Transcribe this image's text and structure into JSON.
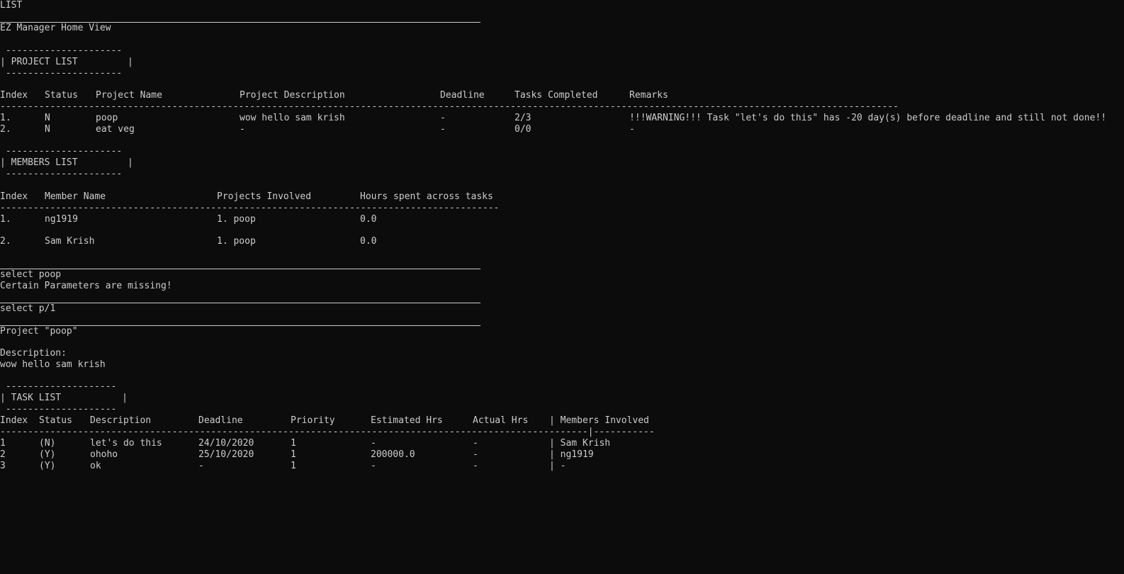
{
  "terminal": {
    "cmd_list": "LIST",
    "home_title": "EZ Manager Home View",
    "project_box": {
      "top": " ---------------------",
      "mid": "| PROJECT LIST         |",
      "bot": " ---------------------"
    },
    "project_table": {
      "headers": [
        "Index",
        "Status",
        "Project Name",
        "Project Description",
        "Deadline",
        "Tasks Completed",
        "Remarks"
      ],
      "divider": "------------------------------------------------------------------------------------------------------------------------------------------------------------------",
      "rows": [
        [
          "1.",
          "N",
          "poop",
          "wow hello sam krish",
          "-",
          "2/3",
          "!!!WARNING!!! Task \"let's do this\" has -20 day(s) before deadline and still not done!!"
        ],
        [
          "2.",
          "N",
          "eat veg",
          "-",
          "-",
          "0/0",
          "-"
        ]
      ]
    },
    "members_box": {
      "top": " ---------------------",
      "mid": "| MEMBERS LIST         |",
      "bot": " ---------------------"
    },
    "members_table": {
      "headers": [
        "Index",
        "Member Name",
        "Projects Involved",
        "Hours spent across tasks"
      ],
      "divider": "----------------------------------------------------------------------------------------------",
      "rows": [
        [
          "1.",
          "ng1919",
          "1. poop",
          "0.0"
        ],
        [
          "2.",
          "Sam Krish",
          "1. poop",
          "0.0"
        ]
      ]
    },
    "cmd_select_poop": "select poop",
    "error_msg": "Certain Parameters are missing!",
    "cmd_select_p1": "select p/1",
    "project_heading": "Project \"poop\"",
    "description_label": "Description:",
    "description_text": "wow hello sam krish",
    "task_box": {
      "top": " --------------------",
      "mid": "| TASK LIST           |",
      "bot": " --------------------"
    },
    "task_table": {
      "headers": [
        "Index",
        "Status",
        "Description",
        "Deadline",
        "Priority",
        "Estimated Hrs",
        "Actual Hrs",
        "| Members Involved"
      ],
      "divider": "----------------------------------------------------------------------------------------------------------|------------------",
      "rows": [
        [
          "1",
          "(N)",
          "let's do this",
          "24/10/2020",
          "1",
          "-",
          "-",
          "| Sam Krish"
        ],
        [
          "2",
          "(Y)",
          "ohoho",
          "25/10/2020",
          "1",
          "200000.0",
          "-",
          "| ng1919"
        ],
        [
          "3",
          "(Y)",
          "ok",
          "-",
          "1",
          "-",
          "-",
          "| -"
        ]
      ]
    }
  }
}
